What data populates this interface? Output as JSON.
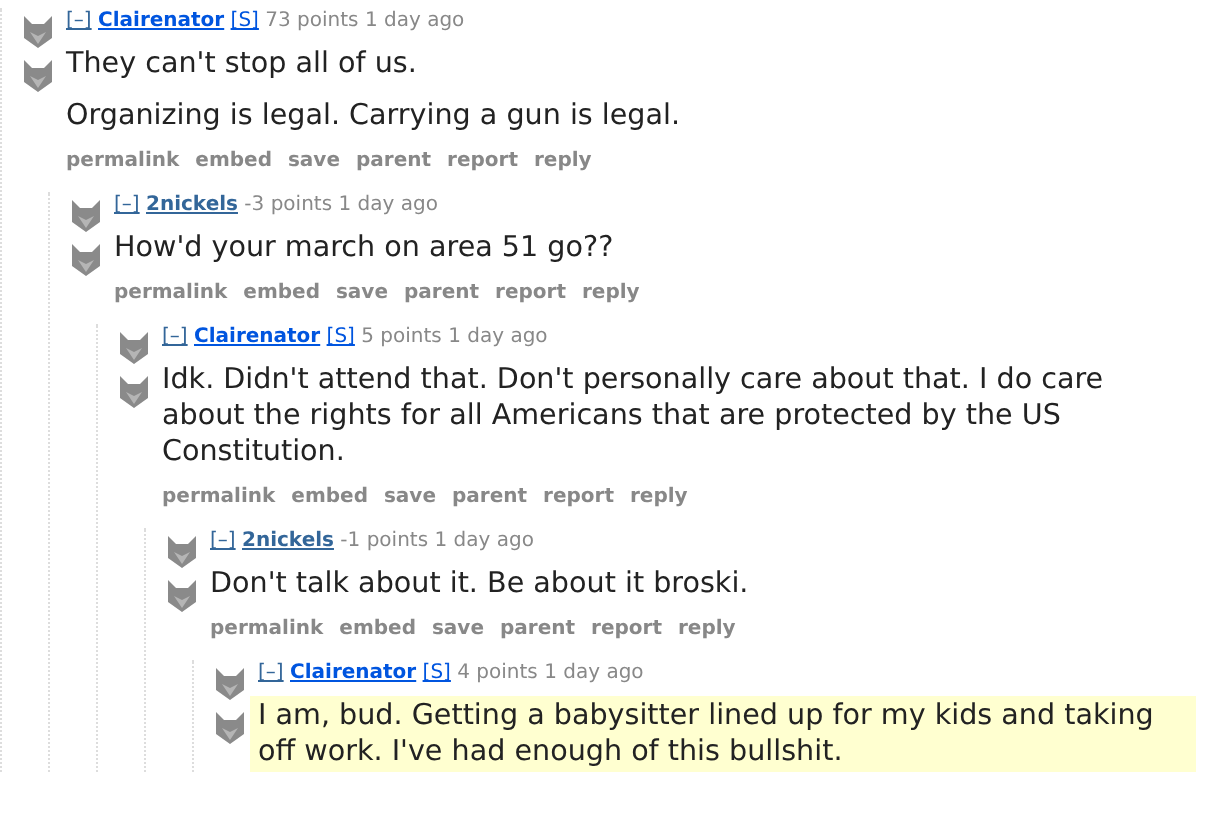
{
  "comments": [
    {
      "toggle": "[–]",
      "author": "Clairenator",
      "kind": "op",
      "submitter_tag": "[S]",
      "points": "73 points",
      "time": "1 day ago",
      "highlighted": false,
      "body": [
        "They can't stop all of us.",
        "Organizing is legal. Carrying a gun is legal."
      ],
      "actions": [
        "permalink",
        "embed",
        "save",
        "parent",
        "report",
        "reply"
      ],
      "children": [
        {
          "toggle": "[–]",
          "author": "2nickels",
          "kind": "user",
          "points": "-3 points",
          "time": "1 day ago",
          "highlighted": false,
          "body": [
            "How'd your march on area 51 go??"
          ],
          "actions": [
            "permalink",
            "embed",
            "save",
            "parent",
            "report",
            "reply"
          ],
          "children": [
            {
              "toggle": "[–]",
              "author": "Clairenator",
              "kind": "op",
              "submitter_tag": "[S]",
              "points": "5 points",
              "time": "1 day ago",
              "highlighted": false,
              "body": [
                "Idk. Didn't attend that. Don't personally care about that. I do care about the rights for all Americans that are protected by the US Constitution."
              ],
              "actions": [
                "permalink",
                "embed",
                "save",
                "parent",
                "report",
                "reply"
              ],
              "children": [
                {
                  "toggle": "[–]",
                  "author": "2nickels",
                  "kind": "user",
                  "points": "-1 points",
                  "time": "1 day ago",
                  "highlighted": false,
                  "body": [
                    "Don't talk about it. Be about it broski."
                  ],
                  "actions": [
                    "permalink",
                    "embed",
                    "save",
                    "parent",
                    "report",
                    "reply"
                  ],
                  "children": [
                    {
                      "toggle": "[–]",
                      "author": "Clairenator",
                      "kind": "op",
                      "submitter_tag": "[S]",
                      "points": "4 points",
                      "time": "1 day ago",
                      "highlighted": true,
                      "body": [
                        "I am, bud. Getting a babysitter lined up for my kids and taking off work. I've had enough of this bullshit."
                      ]
                    }
                  ]
                }
              ]
            }
          ]
        }
      ]
    }
  ]
}
